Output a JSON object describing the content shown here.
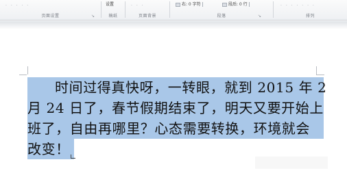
{
  "ribbon": {
    "groups": [
      {
        "label": "页面设置"
      },
      {
        "label": "稿纸"
      },
      {
        "label": "页面背景"
      },
      {
        "label": "段落"
      },
      {
        "label": "排列"
      }
    ],
    "controls": {
      "draft_button": "设置",
      "indent_right": "右: 0 字符",
      "spacing_after": "段后: 0 行"
    }
  },
  "document": {
    "lines": [
      "时间过得真快呀，一转眼，就到 2015 年 2",
      "月 24 日了，春节假期结束了，明天又要开始上",
      "班了，自由再哪里？心态需要转换，环境就会",
      "改变！"
    ]
  }
}
